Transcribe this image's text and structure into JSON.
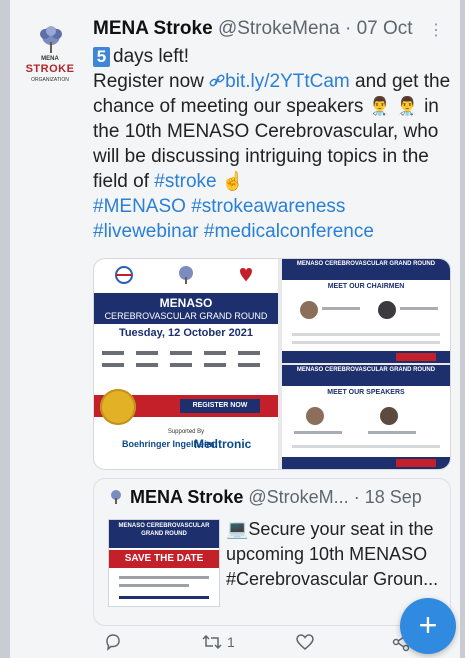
{
  "tweet": {
    "author_name": "MENA Stroke",
    "handle": "@StrokeMena",
    "separator": "·",
    "date": "07 Oct",
    "line1_badge": "5",
    "line1_text": "days left!",
    "register_text": "Register now",
    "link_text": "bit.ly/2YTtCam",
    "after_link": "and get the chance of meeting our speakers",
    "in_text": "in the 10th MENASO Cerebrovascular, who will be discussing intriguing topics in the field of",
    "hashtag_stroke": "#stroke",
    "hashtags_line1": "#MENASO #strokeawareness",
    "hashtags_line2": "#livewebinar #medicalconference"
  },
  "avatar": {
    "org_top": "MENA",
    "org_main": "STROKE",
    "org_bottom": "ORGANIZATION"
  },
  "poster": {
    "title": "MENASO",
    "subtitle": "CEREBROVASCULAR GRAND ROUND",
    "date": "Tuesday, 12 October 2021",
    "register": "REGISTER NOW",
    "supported_by": "Supported By",
    "sponsor1": "Boehringer Ingelheim",
    "sponsor2": "Medtronic"
  },
  "panels": {
    "top_header": "MENASO CEREBROVASCULAR GRAND ROUND",
    "top_title": "MEET OUR CHAIRMEN",
    "bottom_header": "MENASO CEREBROVASCULAR GRAND ROUND",
    "bottom_title": "MEET OUR SPEAKERS"
  },
  "quote": {
    "author_name": "MENA Stroke",
    "handle": "@StrokeM...",
    "separator": "·",
    "date": "18 Sep",
    "text": "Secure your seat in the upcoming 10th MENASO #Cerebrovascular Groun...",
    "thumb_title": "MENASO CEREBROVASCULAR GRAND ROUND",
    "thumb_save": "SAVE THE DATE"
  },
  "actions": {
    "retweet_count": "1"
  },
  "fab": {
    "icon": "plus-icon"
  }
}
